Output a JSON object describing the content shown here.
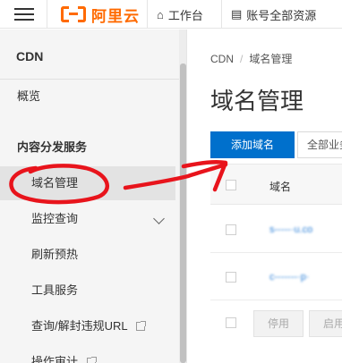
{
  "topbar": {
    "logo_text": "阿里云",
    "workbench_label": "工作台",
    "resources_label": "账号全部资源"
  },
  "sidebar": {
    "title": "CDN",
    "items": [
      {
        "label": "概览"
      },
      {
        "label": "内容分发服务"
      },
      {
        "label": "域名管理"
      },
      {
        "label": "监控查询"
      },
      {
        "label": "刷新预热"
      },
      {
        "label": "工具服务"
      },
      {
        "label": "查询/解封违规URL"
      },
      {
        "label": "操作审计"
      }
    ]
  },
  "main": {
    "breadcrumb": [
      "CDN",
      "域名管理"
    ],
    "breadcrumb_sep": "/",
    "title": "域名管理",
    "add_domain_button": "添加域名",
    "business_filter": "全部业务",
    "table": {
      "header": "域名",
      "rows": [
        "s-----·u.co",
        "c-------·p·"
      ]
    },
    "footer_buttons": [
      "停用",
      "启用"
    ]
  },
  "annotation": {
    "color": "#e8141c"
  }
}
